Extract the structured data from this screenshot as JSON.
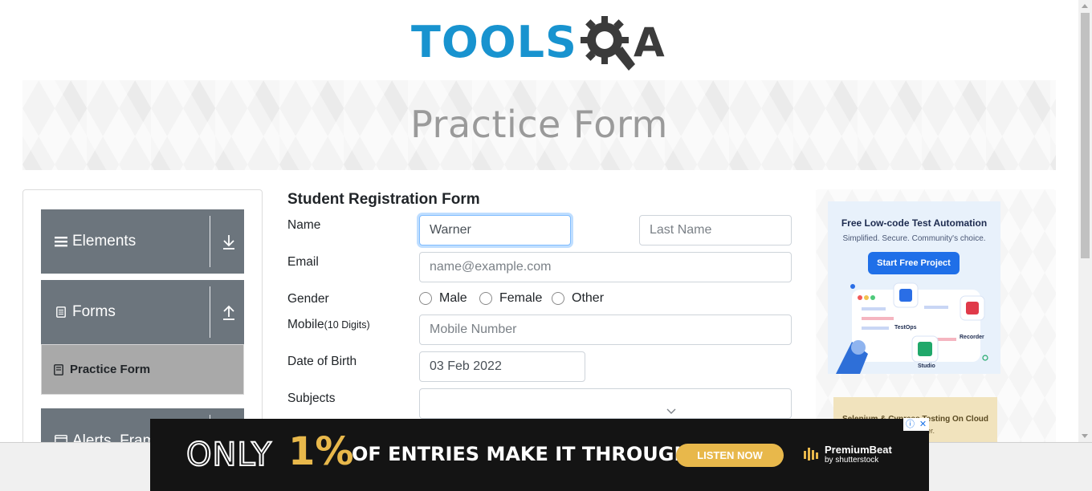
{
  "header": {
    "logo_text_1": "TOOLS",
    "logo_text_2": "A"
  },
  "banner": {
    "title": "Practice Form"
  },
  "sidebar": {
    "groups": [
      {
        "label": "Elements",
        "icon": "list-icon",
        "arrow": "arrow-down-icon"
      },
      {
        "label": "Forms",
        "icon": "document-icon",
        "arrow": "arrow-up-icon"
      },
      {
        "label": "Alerts, Fram",
        "icon": "window-icon"
      }
    ],
    "active_item": {
      "label": "Practice Form",
      "icon": "form-icon"
    }
  },
  "form": {
    "title": "Student Registration Form",
    "name_label": "Name",
    "first_name": {
      "value": "Warner",
      "placeholder": "First Name"
    },
    "last_name": {
      "value": "",
      "placeholder": "Last Name"
    },
    "email_label": "Email",
    "email": {
      "value": "",
      "placeholder": "name@example.com"
    },
    "gender_label": "Gender",
    "gender_options": [
      "Male",
      "Female",
      "Other"
    ],
    "mobile_label": "Mobile",
    "mobile_hint": "(10 Digits)",
    "mobile": {
      "value": "",
      "placeholder": "Mobile Number"
    },
    "dob_label": "Date of Birth",
    "dob": {
      "value": "03 Feb 2022"
    },
    "subjects_label": "Subjects"
  },
  "ads": {
    "ad1": {
      "title": "Free Low-code Test Automation",
      "subtitle": "Simplified. Secure. Community's choice.",
      "button": "Start Free Project",
      "captions": [
        "TestOps",
        "Recorder",
        "Studio"
      ]
    },
    "ad2": {
      "line1": "Selenium & Cypress Testing On Cloud",
      "line2": "Ship Faster."
    }
  },
  "bottom_ad": {
    "only": "ONLY",
    "percent": "1%",
    "text": "OF ENTRIES MAKE IT THROUGH",
    "button": "LISTEN NOW",
    "brand_name": "PremiumBeat",
    "brand_sub": "by shutterstock"
  },
  "colors": {
    "brand_blue": "#1893cf",
    "sidebar_group": "#6c757d",
    "active_item": "#a9a9a9",
    "ad_gold": "#e8b84b"
  }
}
